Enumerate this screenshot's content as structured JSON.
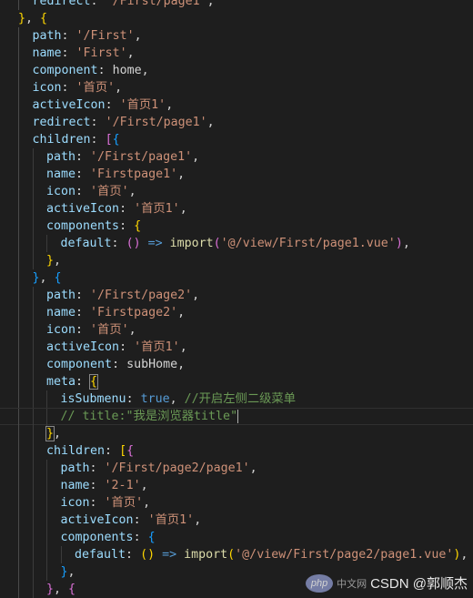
{
  "lines": [
    {
      "indent": 1,
      "tokens": [
        {
          "t": "redirect",
          "c": "k"
        },
        {
          "t": ": ",
          "c": "p"
        },
        {
          "t": "'/First/page1'",
          "c": "s"
        },
        {
          "t": ",",
          "c": "p"
        }
      ]
    },
    {
      "indent": 0,
      "tokens": [
        {
          "t": "}",
          "c": "y"
        },
        {
          "t": ", ",
          "c": "p"
        },
        {
          "t": "{",
          "c": "y"
        }
      ]
    },
    {
      "indent": 1,
      "tokens": [
        {
          "t": "path",
          "c": "k"
        },
        {
          "t": ": ",
          "c": "p"
        },
        {
          "t": "'/First'",
          "c": "s"
        },
        {
          "t": ",",
          "c": "p"
        }
      ]
    },
    {
      "indent": 1,
      "tokens": [
        {
          "t": "name",
          "c": "k"
        },
        {
          "t": ": ",
          "c": "p"
        },
        {
          "t": "'First'",
          "c": "s"
        },
        {
          "t": ",",
          "c": "p"
        }
      ]
    },
    {
      "indent": 1,
      "tokens": [
        {
          "t": "component",
          "c": "k"
        },
        {
          "t": ": ",
          "c": "p"
        },
        {
          "t": "home",
          "c": "v"
        },
        {
          "t": ",",
          "c": "p"
        }
      ]
    },
    {
      "indent": 1,
      "tokens": [
        {
          "t": "icon",
          "c": "k"
        },
        {
          "t": ": ",
          "c": "p"
        },
        {
          "t": "'首页'",
          "c": "s"
        },
        {
          "t": ",",
          "c": "p"
        }
      ]
    },
    {
      "indent": 1,
      "tokens": [
        {
          "t": "activeIcon",
          "c": "k"
        },
        {
          "t": ": ",
          "c": "p"
        },
        {
          "t": "'首页1'",
          "c": "s"
        },
        {
          "t": ",",
          "c": "p"
        }
      ]
    },
    {
      "indent": 1,
      "tokens": [
        {
          "t": "redirect",
          "c": "k"
        },
        {
          "t": ": ",
          "c": "p"
        },
        {
          "t": "'/First/page1'",
          "c": "s"
        },
        {
          "t": ",",
          "c": "p"
        }
      ]
    },
    {
      "indent": 1,
      "tokens": [
        {
          "t": "children",
          "c": "k"
        },
        {
          "t": ": ",
          "c": "p"
        },
        {
          "t": "[",
          "c": "m"
        },
        {
          "t": "{",
          "c": "b"
        }
      ]
    },
    {
      "indent": 2,
      "tokens": [
        {
          "t": "path",
          "c": "k"
        },
        {
          "t": ": ",
          "c": "p"
        },
        {
          "t": "'/First/page1'",
          "c": "s"
        },
        {
          "t": ",",
          "c": "p"
        }
      ]
    },
    {
      "indent": 2,
      "tokens": [
        {
          "t": "name",
          "c": "k"
        },
        {
          "t": ": ",
          "c": "p"
        },
        {
          "t": "'Firstpage1'",
          "c": "s"
        },
        {
          "t": ",",
          "c": "p"
        }
      ]
    },
    {
      "indent": 2,
      "tokens": [
        {
          "t": "icon",
          "c": "k"
        },
        {
          "t": ": ",
          "c": "p"
        },
        {
          "t": "'首页'",
          "c": "s"
        },
        {
          "t": ",",
          "c": "p"
        }
      ]
    },
    {
      "indent": 2,
      "tokens": [
        {
          "t": "activeIcon",
          "c": "k"
        },
        {
          "t": ": ",
          "c": "p"
        },
        {
          "t": "'首页1'",
          "c": "s"
        },
        {
          "t": ",",
          "c": "p"
        }
      ]
    },
    {
      "indent": 2,
      "tokens": [
        {
          "t": "components",
          "c": "k"
        },
        {
          "t": ": ",
          "c": "p"
        },
        {
          "t": "{",
          "c": "y"
        }
      ]
    },
    {
      "indent": 3,
      "tokens": [
        {
          "t": "default",
          "c": "k"
        },
        {
          "t": ": ",
          "c": "p"
        },
        {
          "t": "()",
          "c": "m"
        },
        {
          "t": " => ",
          "c": "bl"
        },
        {
          "t": "import",
          "c": "f"
        },
        {
          "t": "(",
          "c": "m"
        },
        {
          "t": "'@/view/First/page1.vue'",
          "c": "s"
        },
        {
          "t": ")",
          "c": "m"
        },
        {
          "t": ",",
          "c": "p"
        }
      ]
    },
    {
      "indent": 2,
      "tokens": [
        {
          "t": "}",
          "c": "y"
        },
        {
          "t": ",",
          "c": "p"
        }
      ]
    },
    {
      "indent": 1,
      "tokens": [
        {
          "t": "}",
          "c": "b"
        },
        {
          "t": ", ",
          "c": "p"
        },
        {
          "t": "{",
          "c": "b"
        }
      ]
    },
    {
      "indent": 2,
      "tokens": [
        {
          "t": "path",
          "c": "k"
        },
        {
          "t": ": ",
          "c": "p"
        },
        {
          "t": "'/First/page2'",
          "c": "s"
        },
        {
          "t": ",",
          "c": "p"
        }
      ]
    },
    {
      "indent": 2,
      "tokens": [
        {
          "t": "name",
          "c": "k"
        },
        {
          "t": ": ",
          "c": "p"
        },
        {
          "t": "'Firstpage2'",
          "c": "s"
        },
        {
          "t": ",",
          "c": "p"
        }
      ]
    },
    {
      "indent": 2,
      "tokens": [
        {
          "t": "icon",
          "c": "k"
        },
        {
          "t": ": ",
          "c": "p"
        },
        {
          "t": "'首页'",
          "c": "s"
        },
        {
          "t": ",",
          "c": "p"
        }
      ]
    },
    {
      "indent": 2,
      "tokens": [
        {
          "t": "activeIcon",
          "c": "k"
        },
        {
          "t": ": ",
          "c": "p"
        },
        {
          "t": "'首页1'",
          "c": "s"
        },
        {
          "t": ",",
          "c": "p"
        }
      ]
    },
    {
      "indent": 2,
      "tokens": [
        {
          "t": "component",
          "c": "k"
        },
        {
          "t": ": ",
          "c": "p"
        },
        {
          "t": "subHome",
          "c": "v"
        },
        {
          "t": ",",
          "c": "p"
        }
      ]
    },
    {
      "indent": 2,
      "tokens": [
        {
          "t": "meta",
          "c": "k"
        },
        {
          "t": ": ",
          "c": "p"
        },
        {
          "t": "{",
          "c": "y",
          "hl": true
        }
      ]
    },
    {
      "indent": 3,
      "tokens": [
        {
          "t": "isSubmenu",
          "c": "k"
        },
        {
          "t": ": ",
          "c": "p"
        },
        {
          "t": "true",
          "c": "bl"
        },
        {
          "t": ", ",
          "c": "p"
        },
        {
          "t": "//开启左侧二级菜单",
          "c": "c"
        }
      ]
    },
    {
      "indent": 3,
      "current": true,
      "tokens": [
        {
          "t": "// title:\"我是浏览器title\"",
          "c": "c"
        }
      ]
    },
    {
      "indent": 2,
      "tokens": [
        {
          "t": "}",
          "c": "y",
          "hl": true
        },
        {
          "t": ",",
          "c": "p"
        }
      ]
    },
    {
      "indent": 2,
      "tokens": [
        {
          "t": "children",
          "c": "k"
        },
        {
          "t": ": ",
          "c": "p"
        },
        {
          "t": "[",
          "c": "y"
        },
        {
          "t": "{",
          "c": "m"
        }
      ]
    },
    {
      "indent": 3,
      "tokens": [
        {
          "t": "path",
          "c": "k"
        },
        {
          "t": ": ",
          "c": "p"
        },
        {
          "t": "'/First/page2/page1'",
          "c": "s"
        },
        {
          "t": ",",
          "c": "p"
        }
      ]
    },
    {
      "indent": 3,
      "tokens": [
        {
          "t": "name",
          "c": "k"
        },
        {
          "t": ": ",
          "c": "p"
        },
        {
          "t": "'2-1'",
          "c": "s"
        },
        {
          "t": ",",
          "c": "p"
        }
      ]
    },
    {
      "indent": 3,
      "tokens": [
        {
          "t": "icon",
          "c": "k"
        },
        {
          "t": ": ",
          "c": "p"
        },
        {
          "t": "'首页'",
          "c": "s"
        },
        {
          "t": ",",
          "c": "p"
        }
      ]
    },
    {
      "indent": 3,
      "tokens": [
        {
          "t": "activeIcon",
          "c": "k"
        },
        {
          "t": ": ",
          "c": "p"
        },
        {
          "t": "'首页1'",
          "c": "s"
        },
        {
          "t": ",",
          "c": "p"
        }
      ]
    },
    {
      "indent": 3,
      "tokens": [
        {
          "t": "components",
          "c": "k"
        },
        {
          "t": ": ",
          "c": "p"
        },
        {
          "t": "{",
          "c": "b"
        }
      ]
    },
    {
      "indent": 4,
      "tokens": [
        {
          "t": "default",
          "c": "k"
        },
        {
          "t": ": ",
          "c": "p"
        },
        {
          "t": "()",
          "c": "y"
        },
        {
          "t": " => ",
          "c": "bl"
        },
        {
          "t": "import",
          "c": "f"
        },
        {
          "t": "(",
          "c": "y"
        },
        {
          "t": "'@/view/First/page2/page1.vue'",
          "c": "s"
        },
        {
          "t": ")",
          "c": "y"
        },
        {
          "t": ",",
          "c": "p"
        }
      ]
    },
    {
      "indent": 3,
      "tokens": [
        {
          "t": "}",
          "c": "b"
        },
        {
          "t": ",",
          "c": "p"
        }
      ]
    },
    {
      "indent": 2,
      "tokens": [
        {
          "t": "}",
          "c": "m"
        },
        {
          "t": ", ",
          "c": "p"
        },
        {
          "t": "{",
          "c": "m"
        }
      ]
    }
  ],
  "watermark": {
    "logo_text": "php",
    "site_text": "中文网",
    "text": "CSDN @郭顺杰"
  }
}
